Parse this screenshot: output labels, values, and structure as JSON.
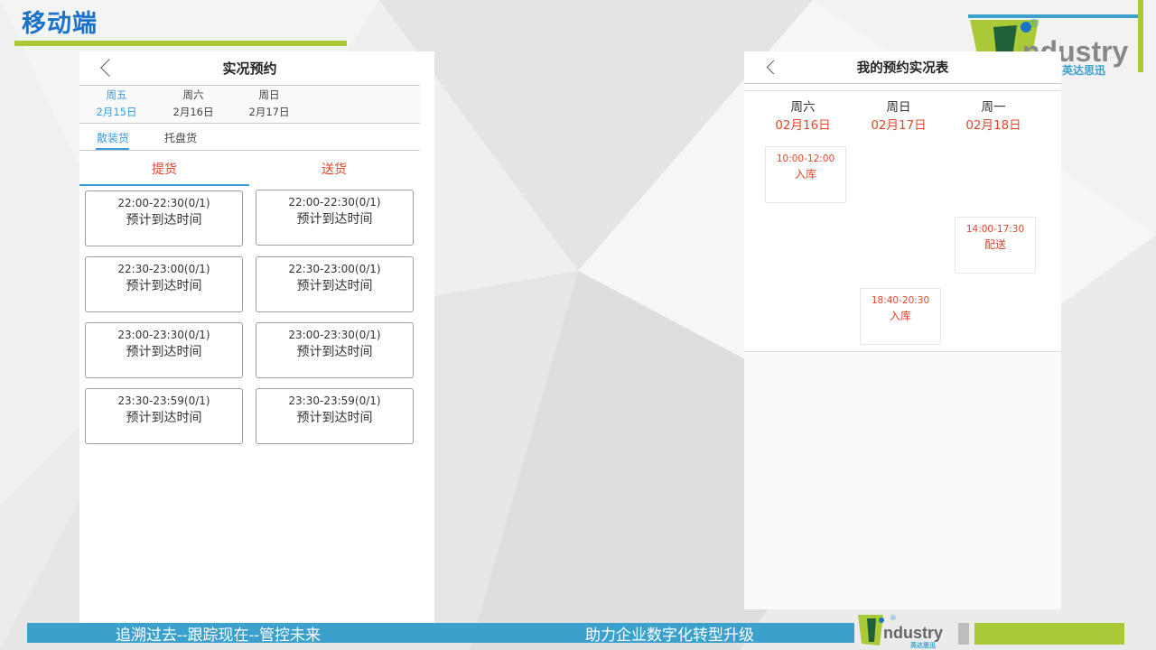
{
  "page": {
    "title": "移动端",
    "footer_left": "追溯过去--跟踪现在--管控未来",
    "footer_right": "助力企业数字化转型升级",
    "brand": {
      "logo_text": "ndustry",
      "logo_cn": "英达思迅",
      "registered": "®"
    },
    "colors": {
      "title_blue": "#1a73c8",
      "accent_green": "#a9c936",
      "footer_blue": "#3ba0cc",
      "accent_red": "#e0472a",
      "tab_blue": "#3a9ad9"
    }
  },
  "reservation_screen": {
    "back_icon": "chevron-left-icon",
    "title": "实况预约",
    "days": [
      {
        "weekday": "周五",
        "date": "2月15日",
        "active": true
      },
      {
        "weekday": "周六",
        "date": "2月16日",
        "active": false
      },
      {
        "weekday": "周日",
        "date": "2月17日",
        "active": false
      }
    ],
    "categories": [
      {
        "label": "散装货",
        "active": true
      },
      {
        "label": "托盘货",
        "active": false
      }
    ],
    "modes": [
      {
        "label": "提货",
        "active": true
      },
      {
        "label": "送货",
        "active": false
      }
    ],
    "slots_pickup": [
      {
        "time": "22:00-22:30(0/1)",
        "label": "预计到达时间"
      },
      {
        "time": "22:30-23:00(0/1)",
        "label": "预计到达时间"
      },
      {
        "time": "23:00-23:30(0/1)",
        "label": "预计到达时间"
      },
      {
        "time": "23:30-23:59(0/1)",
        "label": "预计到达时间"
      }
    ],
    "slots_delivery": [
      {
        "time": "22:00-22:30(0/1)",
        "label": "预计到达时间"
      },
      {
        "time": "22:30-23:00(0/1)",
        "label": "预计到达时间"
      },
      {
        "time": "23:00-23:30(0/1)",
        "label": "预计到达时间"
      },
      {
        "time": "23:30-23:59(0/1)",
        "label": "预计到达时间"
      }
    ]
  },
  "schedule_screen": {
    "back_icon": "chevron-left-icon",
    "title": "我的预约实况表",
    "days": [
      {
        "weekday": "周六",
        "date": "02月16日"
      },
      {
        "weekday": "周日",
        "date": "02月17日"
      },
      {
        "weekday": "周一",
        "date": "02月18日"
      }
    ],
    "events": [
      {
        "time": "10:00-12:00",
        "kind": "入库"
      },
      {
        "time": "14:00-17:30",
        "kind": "配送"
      },
      {
        "time": "18:40-20:30",
        "kind": "入库"
      }
    ]
  }
}
